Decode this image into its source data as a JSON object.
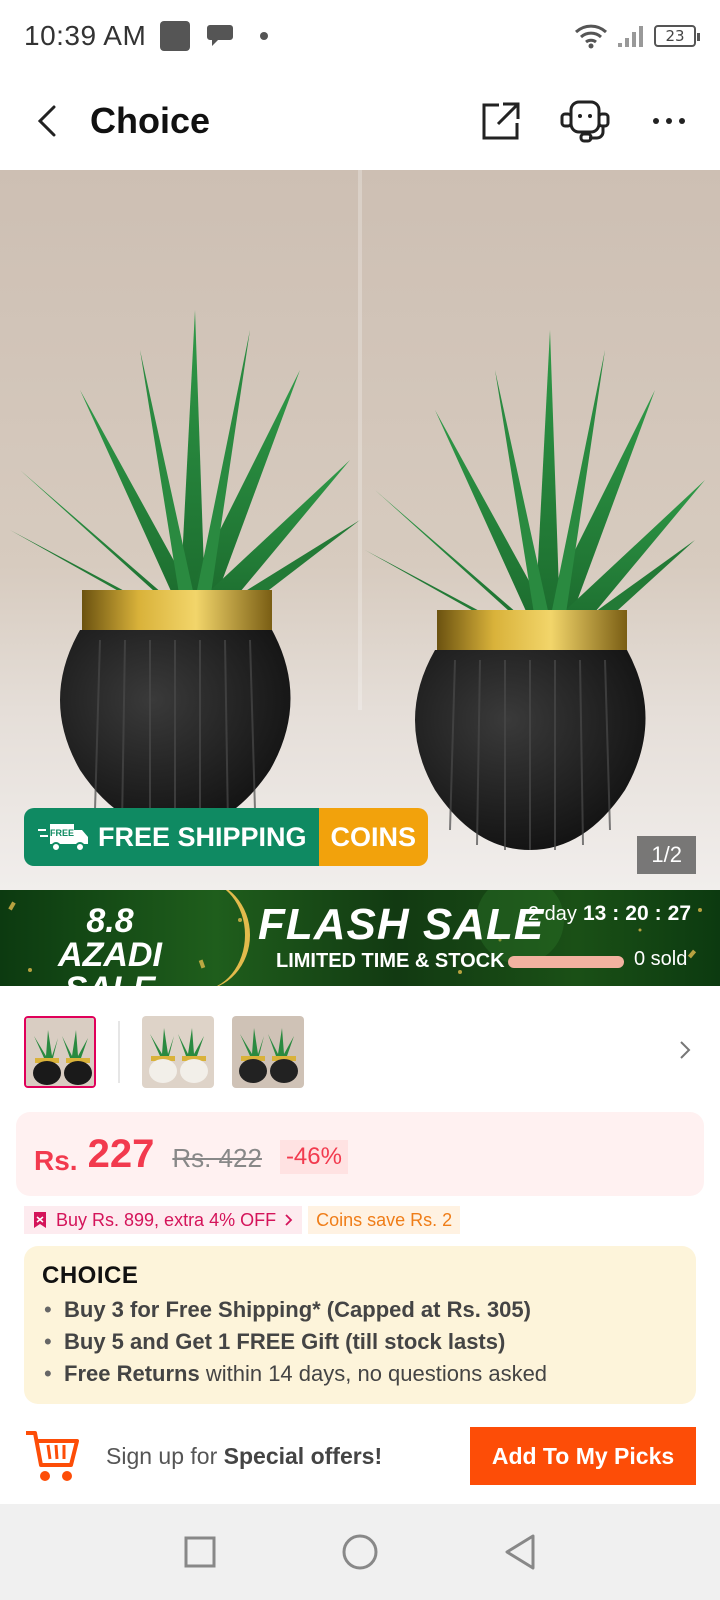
{
  "status_bar": {
    "time": "10:39 AM",
    "battery": "23"
  },
  "header": {
    "title": "Choice",
    "icons": [
      "back-icon",
      "share-icon",
      "support-agent-icon",
      "more-icon"
    ]
  },
  "hero": {
    "badge_free_shipping": "FREE SHIPPING",
    "badge_free_small": "FREE",
    "badge_coins": "COINS",
    "pager": "1/2"
  },
  "flash_sale": {
    "azadi_line1": "8.8 AZADI",
    "azadi_line2": "SALE",
    "title": "FLASH SALE",
    "subtitle": "LIMITED TIME & STOCK",
    "days": "2 day",
    "hours": "13",
    "minutes": "20",
    "seconds": "27",
    "sold": "0 sold"
  },
  "price": {
    "currency": "Rs.",
    "current": "227",
    "original": "Rs. 422",
    "discount": "-46%"
  },
  "badges": {
    "buy_offer": "Buy Rs. 899, extra 4% OFF",
    "coins_save": "Coins save Rs. 2"
  },
  "choice": {
    "logo": "CHOICE",
    "line1": "Buy 3 for  Free Shipping* (Capped at Rs. 305)",
    "line2": "Buy 5 and Get 1 FREE Gift (till stock lasts)",
    "line3_bold": "Free Returns",
    "line3_rest": " within 14 days, no questions asked"
  },
  "signup": {
    "text_prefix": "Sign up for ",
    "text_bold": "Special offers!",
    "button": "Add To My Picks"
  },
  "colors": {
    "accent_red": "#f23a4e",
    "button_orange": "#fd4d07",
    "shipping_green": "#0f8a62",
    "coins_orange": "#f2a20c"
  }
}
